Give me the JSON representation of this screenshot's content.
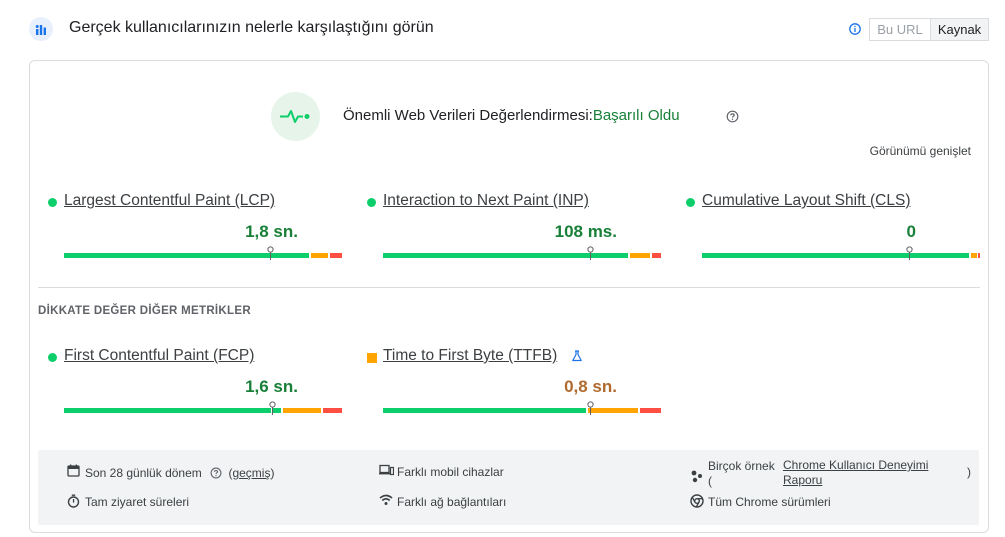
{
  "header": {
    "title": "Gerçek kullanıcılarınızın nelerle karşılaştığını görün",
    "toggle": {
      "this_url": "Bu URL",
      "origin": "Kaynak"
    }
  },
  "assessment": {
    "label": "Önemli Web Verileri Değerlendirmesi:",
    "result": "Başarılı Oldu",
    "expand": "Görünümü genişlet"
  },
  "core_metrics": [
    {
      "name": "Largest Contentful Paint (LCP)",
      "value": "1,8 sn.",
      "status": "good"
    },
    {
      "name": "Interaction to Next Paint (INP)",
      "value": "108 ms.",
      "status": "good"
    },
    {
      "name": "Cumulative Layout Shift (CLS)",
      "value": "0",
      "status": "good"
    }
  ],
  "other_section_title": "DİKKATE DEĞER DİĞER METRİKLER",
  "other_metrics": [
    {
      "name": "First Contentful Paint (FCP)",
      "value": "1,6 sn.",
      "status": "good"
    },
    {
      "name": "Time to First Byte (TTFB)",
      "value": "0,8 sn.",
      "status": "needs-improvement"
    }
  ],
  "footer": {
    "period": "Son 28 günlük dönem",
    "period_history_open": "(",
    "period_history": "geçmiş",
    "period_history_close": ")",
    "visits": "Tam ziyaret süreleri",
    "devices": "Farklı mobil cihazlar",
    "network": "Farklı ağ bağlantıları",
    "samples_prefix": "Birçok örnek",
    "samples_paren_open": "(",
    "samples_link_line1": "Chrome Kullanıcı Deneyimi",
    "samples_link_line2": "Raporu",
    "samples_paren_close": ")",
    "chrome_versions": "Tüm Chrome sürümleri"
  },
  "colors": {
    "good": "#0cce6b",
    "needs_improvement": "#ffa400",
    "poor": "#ff4e42",
    "pass_text": "#188038"
  }
}
